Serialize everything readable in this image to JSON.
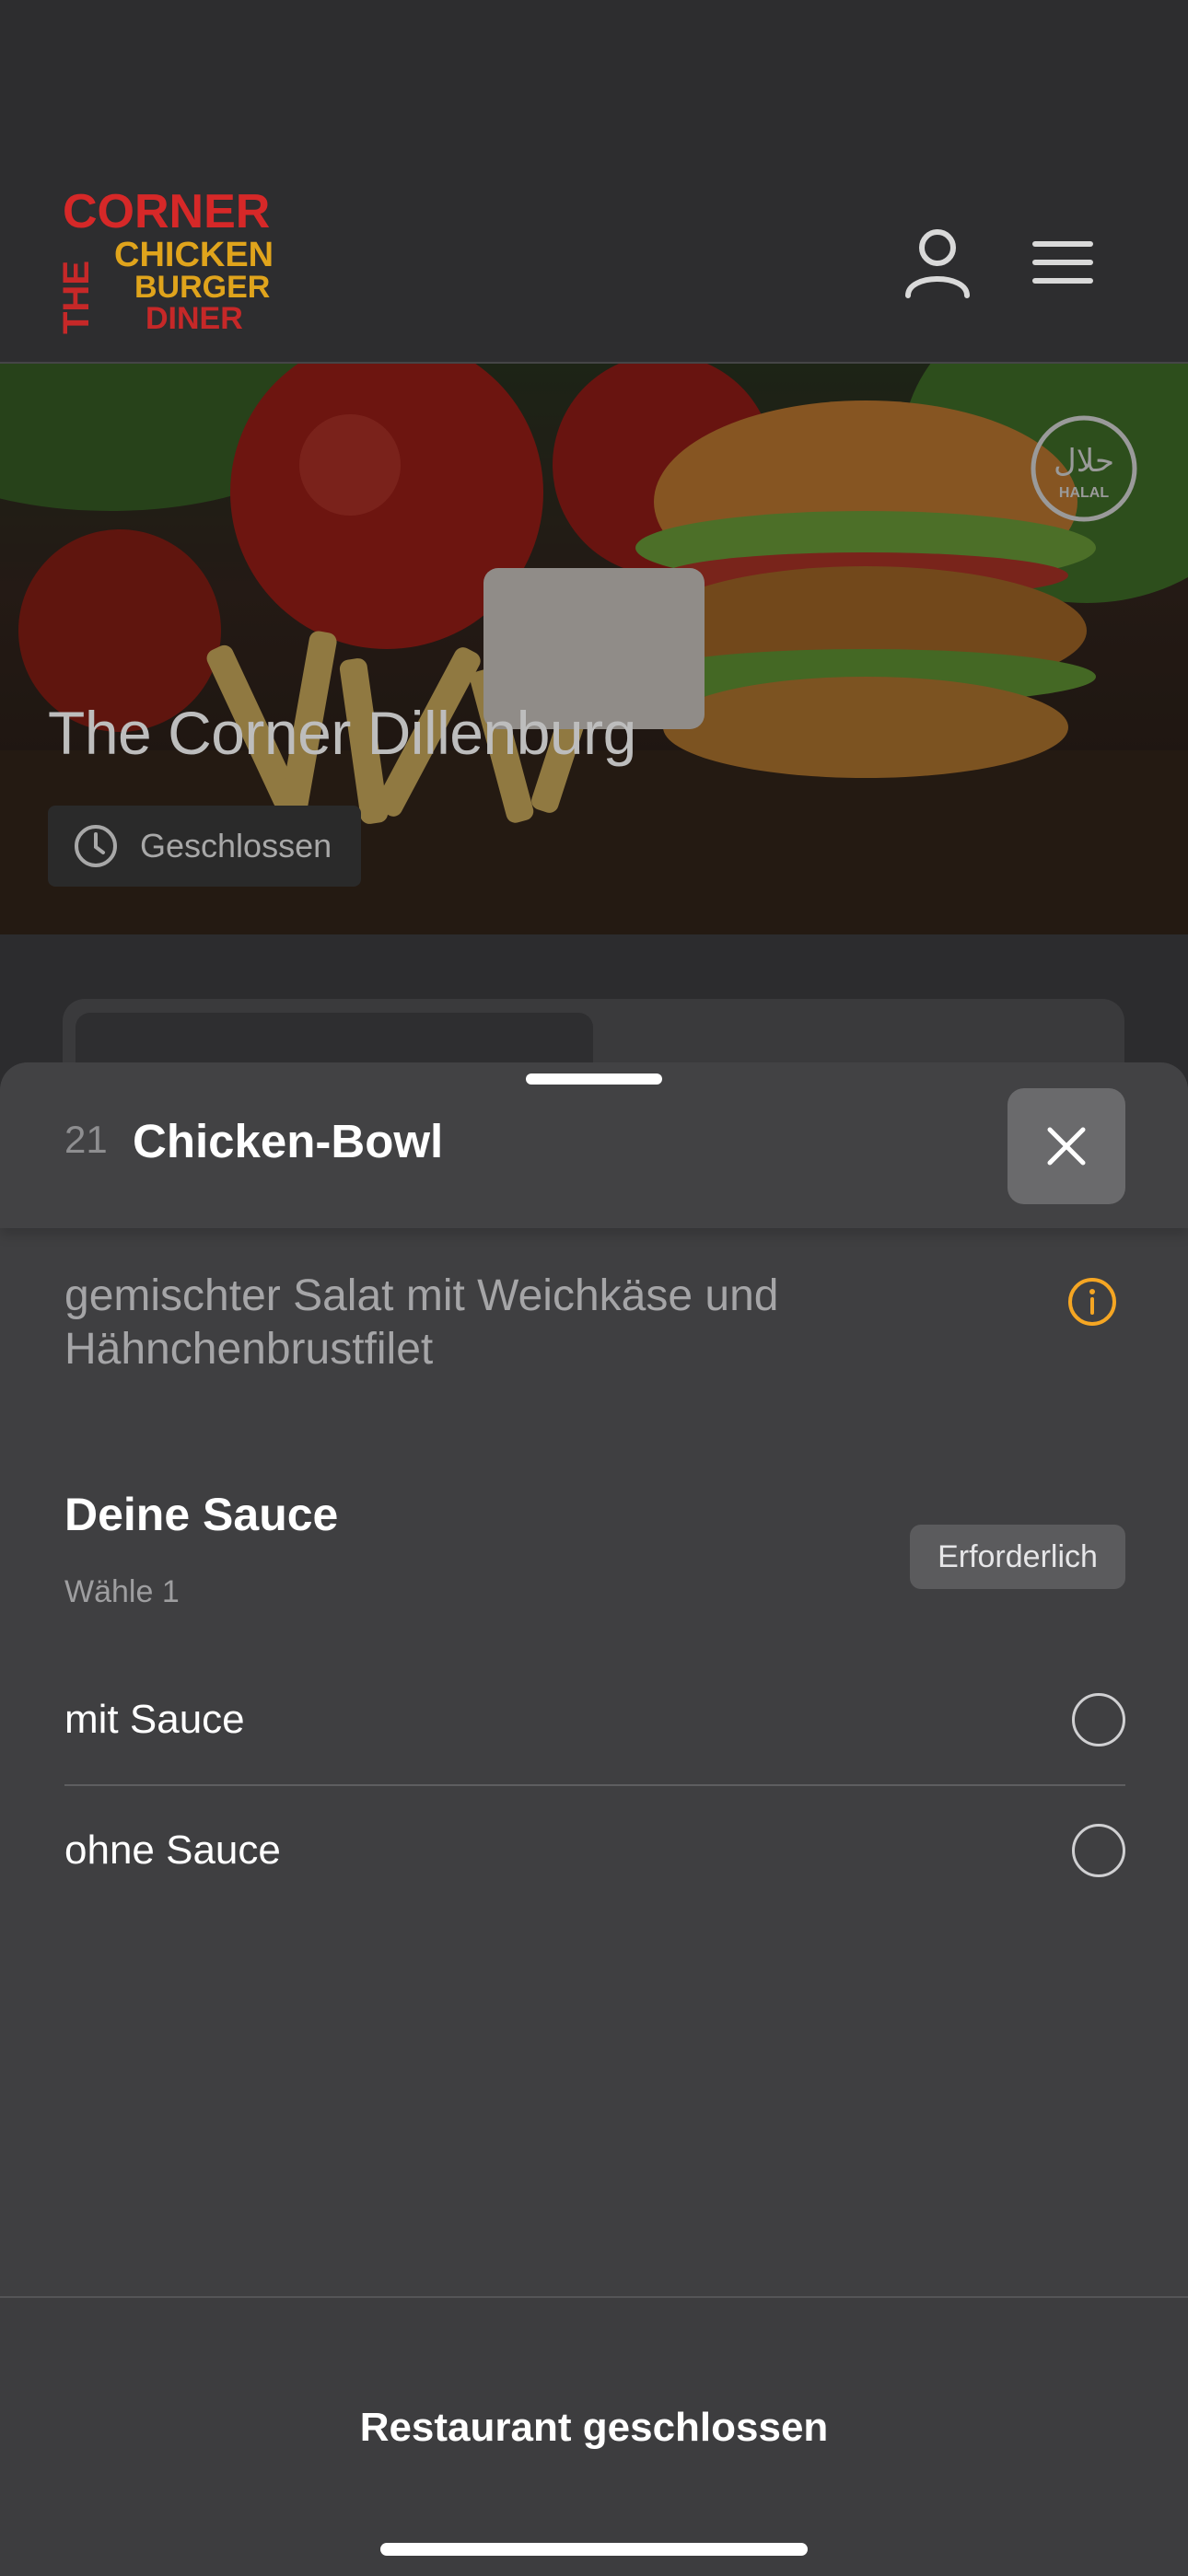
{
  "header": {
    "logo_top": "THE",
    "logo_line1": "CORNER",
    "logo_line2": "CHICKEN",
    "logo_line3": "BURGER",
    "logo_line4": "DINER",
    "account_icon": "person-icon",
    "menu_icon": "hamburger-menu-icon"
  },
  "hero": {
    "restaurant_name": "The Corner Dillenburg",
    "status": "Geschlossen",
    "status_icon": "clock-icon",
    "badge_text": "HALAL",
    "badge_arabic": "حلال"
  },
  "sheet": {
    "item_number": "21",
    "item_title": "Chicken-Bowl",
    "description": "gemischter Salat mit Weichkäse und Hähnchenbrustfilet",
    "info_icon": "info-icon",
    "section": {
      "title": "Deine Sauce",
      "subtitle": "Wähle 1",
      "required_label": "Erforderlich",
      "options": [
        {
          "label": "mit Sauce",
          "selected": false
        },
        {
          "label": "ohne Sauce",
          "selected": false
        }
      ]
    }
  },
  "footer": {
    "action_label": "Restaurant geschlossen"
  },
  "colors": {
    "accent_red": "#d62828",
    "accent_yellow": "#f2b21b",
    "info_orange": "#f5a623"
  }
}
